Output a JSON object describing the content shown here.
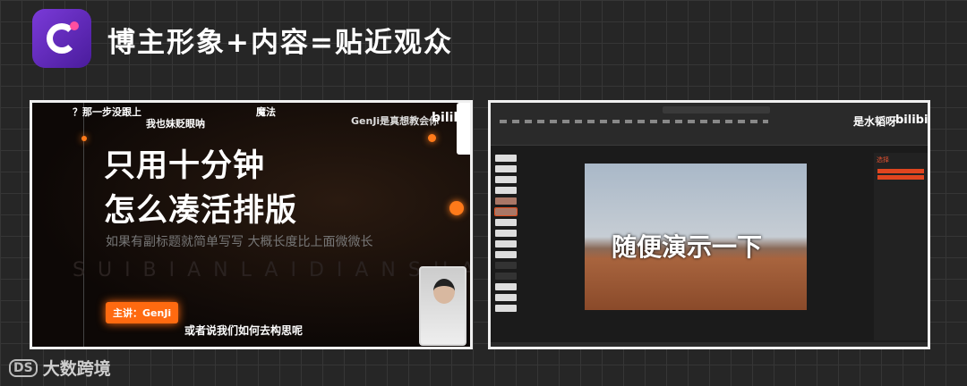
{
  "header": {
    "title": "博主形象+内容=贴近观众"
  },
  "left_video": {
    "danmaku": [
      "？那一步没跟上",
      "我也妹贬眼呐",
      "魔法"
    ],
    "channel": "GenJi是真想教会你",
    "platform": "bilibili",
    "headline": [
      "只用十分钟",
      "怎么凑活排版"
    ],
    "subtitle": "如果有副标题就简单写写 大概长度比上面微微长",
    "watermark": "SUIBIANLAIDIANSHA",
    "presenter": "主讲：GenJi",
    "caption": "或者说我们如何去构思呢"
  },
  "right_video": {
    "slide_text": "随便演示一下",
    "channel": "是水韬呀",
    "platform": "bilibili",
    "pane_title": "选择"
  },
  "footer": {
    "brand": "大数跨境",
    "mark": "DS"
  }
}
